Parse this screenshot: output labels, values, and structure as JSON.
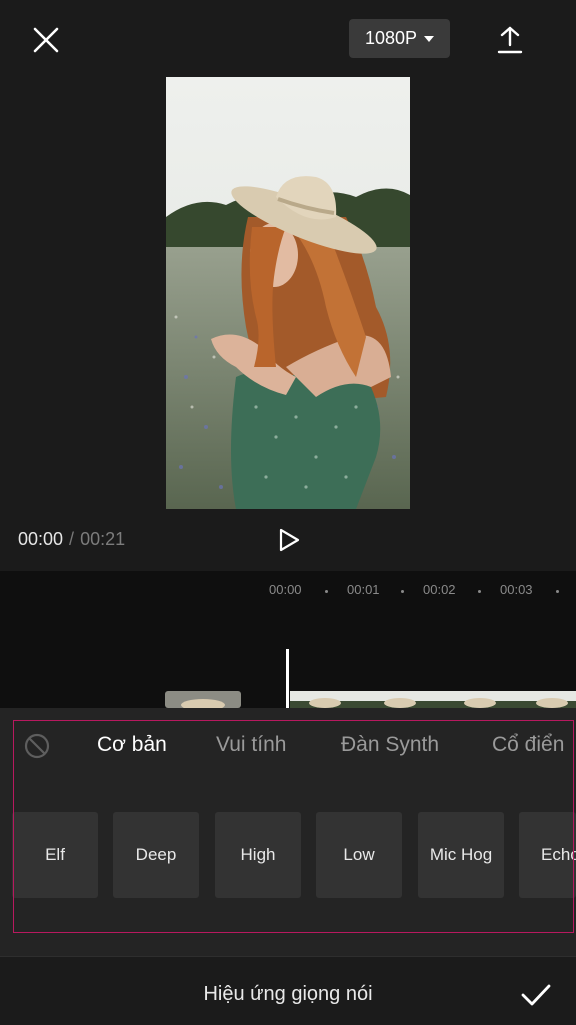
{
  "header": {
    "close_icon": "close-icon",
    "resolution_label": "1080P",
    "export_icon": "upload-icon"
  },
  "player": {
    "current_time": "00:00",
    "separator": "/",
    "total_time": "00:21",
    "play_icon": "play-icon"
  },
  "timeline": {
    "ticks": [
      "00:00",
      "00:01",
      "00:02",
      "00:03"
    ]
  },
  "voice_effects": {
    "none_icon": "prohibited-icon",
    "tabs": [
      {
        "label": "Cơ bản",
        "active": true
      },
      {
        "label": "Vui tính",
        "active": false
      },
      {
        "label": "Đàn Synth",
        "active": false
      },
      {
        "label": "Cổ điển",
        "active": false
      }
    ],
    "items": [
      "Elf",
      "Deep",
      "High",
      "Low",
      "Mic Hog",
      "Echo"
    ]
  },
  "footer": {
    "title": "Hiệu ứng giọng nói",
    "confirm_icon": "check-icon"
  },
  "colors": {
    "background": "#1b1b1b",
    "panel": "#242424",
    "tile": "#333333",
    "highlight_border": "#b8195f"
  }
}
